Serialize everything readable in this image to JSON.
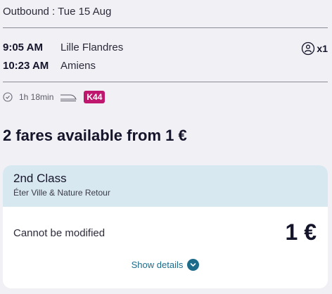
{
  "header": {
    "title": "Outbound : Tue 15 Aug"
  },
  "journey": {
    "departure_time": "9:05 AM",
    "departure_station": "Lille Flandres",
    "arrival_time": "10:23 AM",
    "arrival_station": "Amiens",
    "passengers": "x1",
    "duration": "1h 18min",
    "train_badge": "K44",
    "badge_color": "#c0176e",
    "icons": [
      "clock-icon",
      "train-icon",
      "passenger-icon"
    ]
  },
  "fares": {
    "title": "2 fares available from 1 €",
    "card": {
      "class_name": "2nd Class",
      "fare_name": "Éter Ville & Nature Retour",
      "condition": "Cannot be modified",
      "price": "1 €",
      "details_label": "Show details",
      "header_color": "#d8e8f0",
      "accent_color": "#1c6c8a"
    }
  }
}
